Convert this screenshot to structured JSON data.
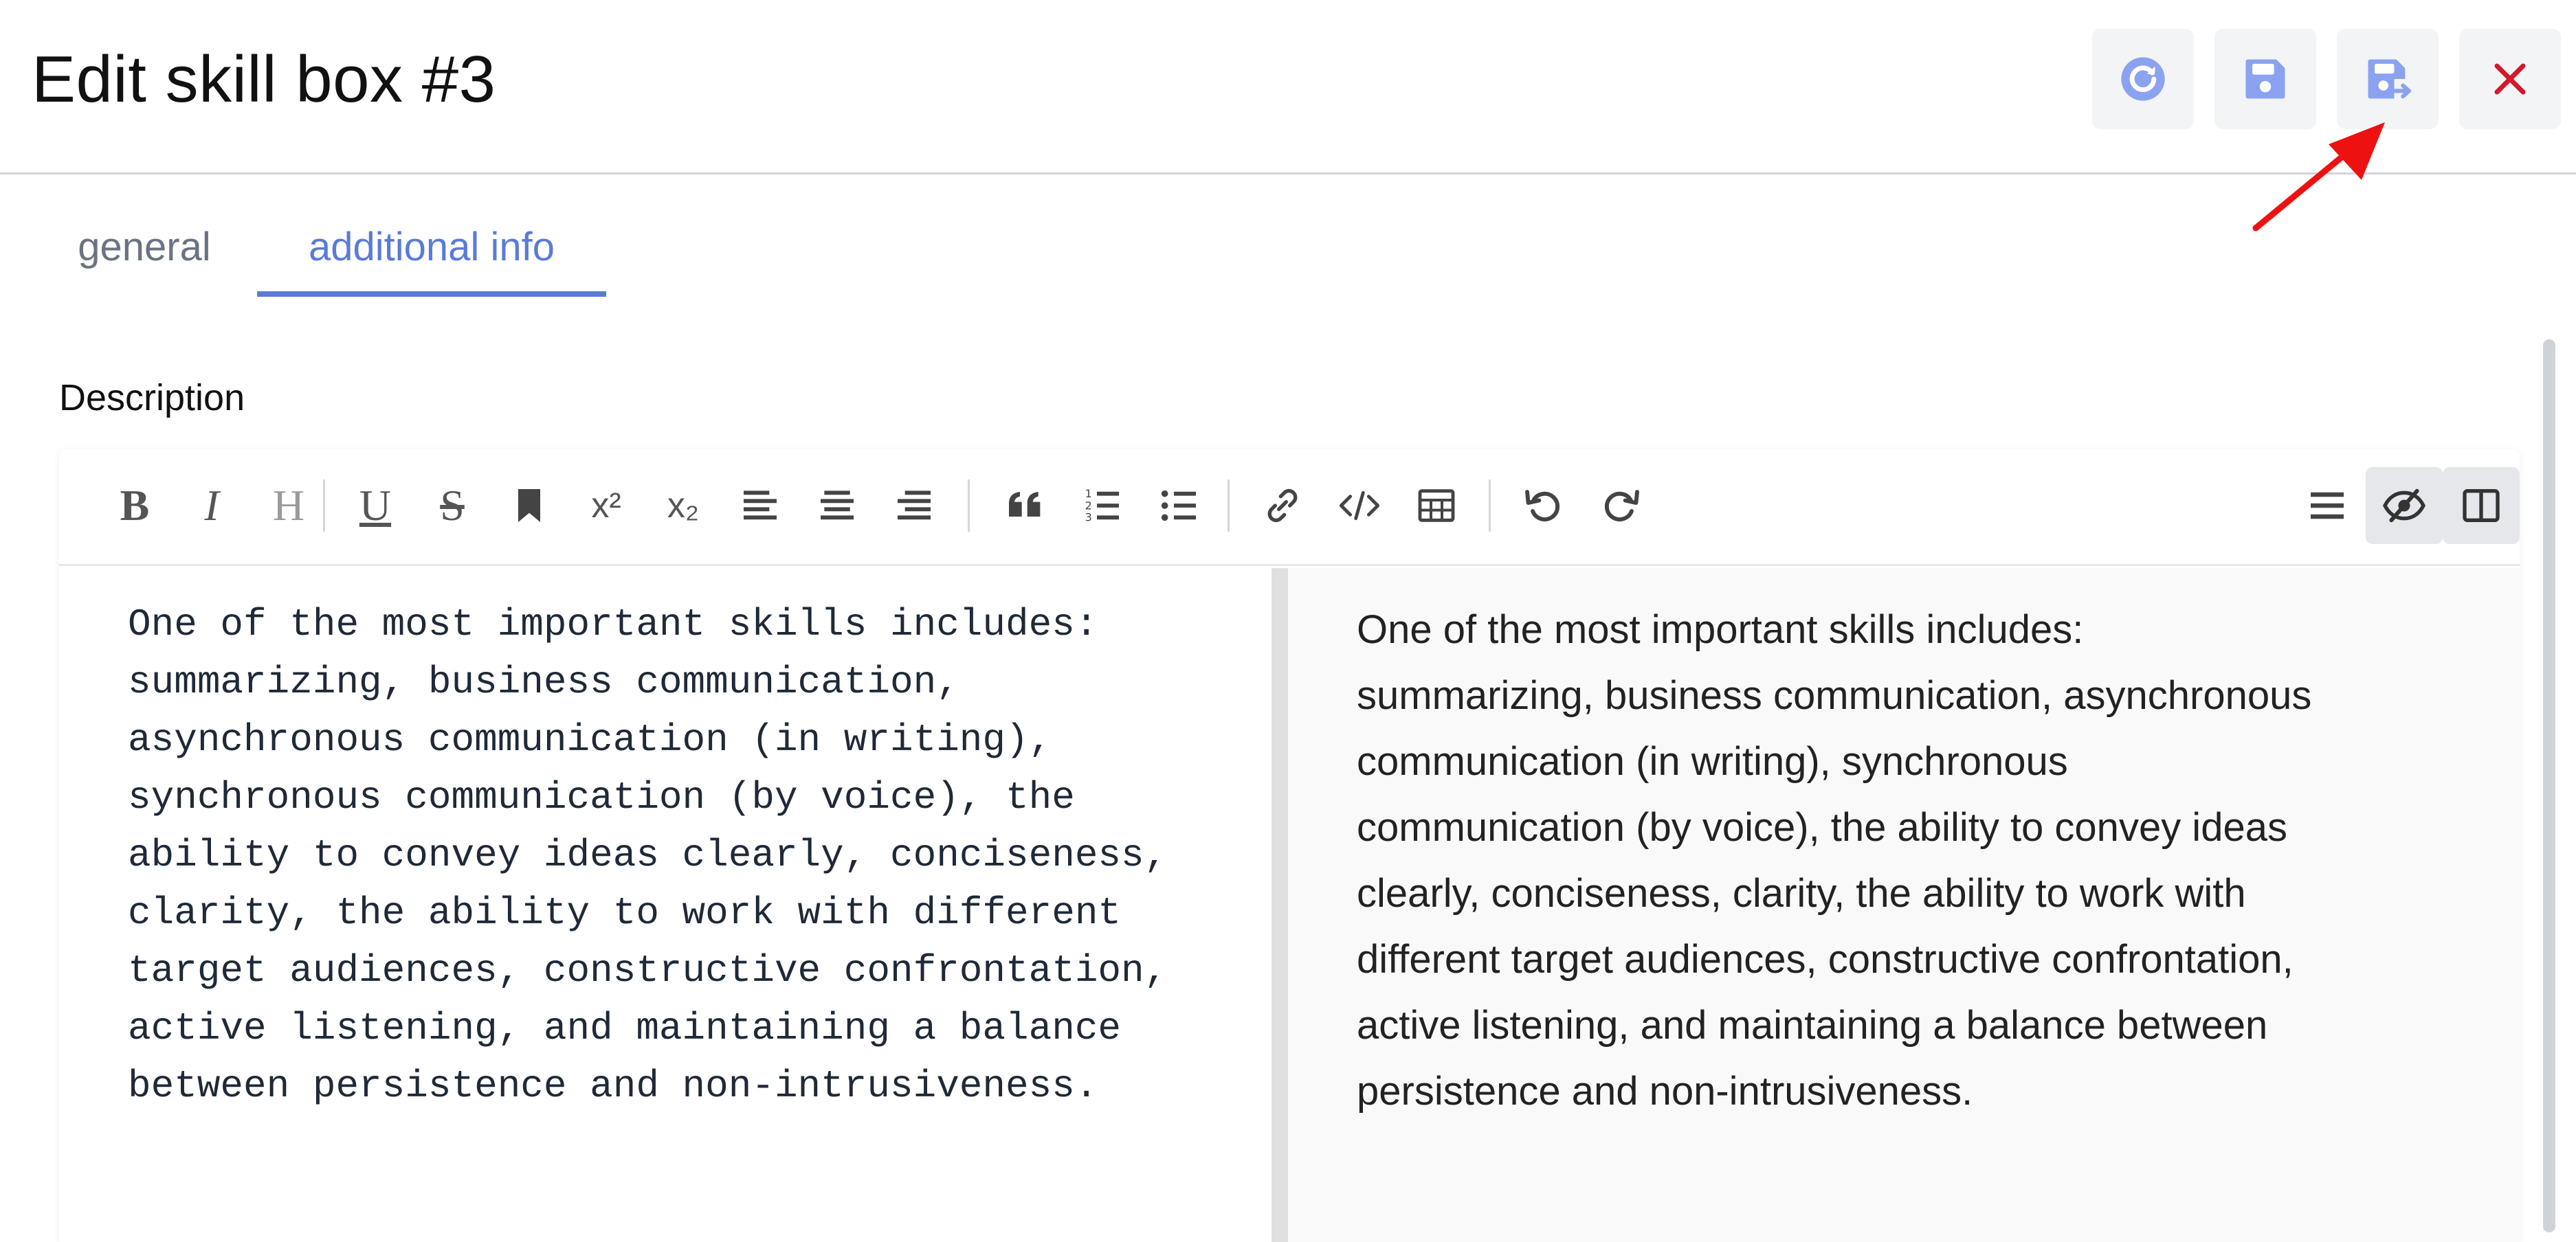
{
  "header": {
    "title": "Edit skill box #3",
    "buttons": [
      {
        "icon": "refresh-icon",
        "color": "#8ba2f0"
      },
      {
        "icon": "save-icon",
        "color": "#8ba2f0"
      },
      {
        "icon": "save-and-close-icon",
        "color": "#8ba2f0"
      },
      {
        "icon": "close-icon",
        "color": "#d11a2a"
      }
    ]
  },
  "annotation": {
    "arrow_color": "#ee1111"
  },
  "tabs": [
    {
      "label": "general",
      "active": false
    },
    {
      "label": "additional info",
      "active": true
    }
  ],
  "form": {
    "description_label": "Description"
  },
  "toolbar": {
    "bold": "B",
    "italic": "I",
    "heading": "H",
    "underline": "U",
    "strike": "S",
    "superscript": "x²",
    "subscript": "x₂",
    "icons": [
      "bold-icon",
      "italic-icon",
      "heading-icon",
      "underline-icon",
      "strikethrough-icon",
      "bookmark-icon",
      "superscript-icon",
      "subscript-icon",
      "align-left-icon",
      "align-center-icon",
      "align-right-icon",
      "quote-icon",
      "ordered-list-icon",
      "unordered-list-icon",
      "link-icon",
      "code-icon",
      "table-icon",
      "undo-icon",
      "redo-icon",
      "menu-icon",
      "preview-toggle-icon",
      "split-view-icon"
    ]
  },
  "editor": {
    "source_lines": [
      "One of the most important skills includes:",
      "summarizing, business communication,",
      "asynchronous communication (in writing),",
      "synchronous communication (by voice), the",
      "ability to convey ideas clearly, conciseness,",
      "clarity, the ability to work with different",
      "target audiences, constructive confrontation,",
      "active listening, and maintaining a balance",
      "between persistence and non-intrusiveness."
    ],
    "preview_lines": [
      "One of the most important skills includes:",
      "summarizing, business communication, asynchronous",
      "communication (in writing), synchronous",
      "communication (by voice), the ability to convey ideas",
      "clearly, conciseness, clarity, the ability to work with",
      "different target audiences, constructive confrontation,",
      "active listening, and maintaining a balance between",
      "persistence and non-intrusiveness."
    ]
  }
}
